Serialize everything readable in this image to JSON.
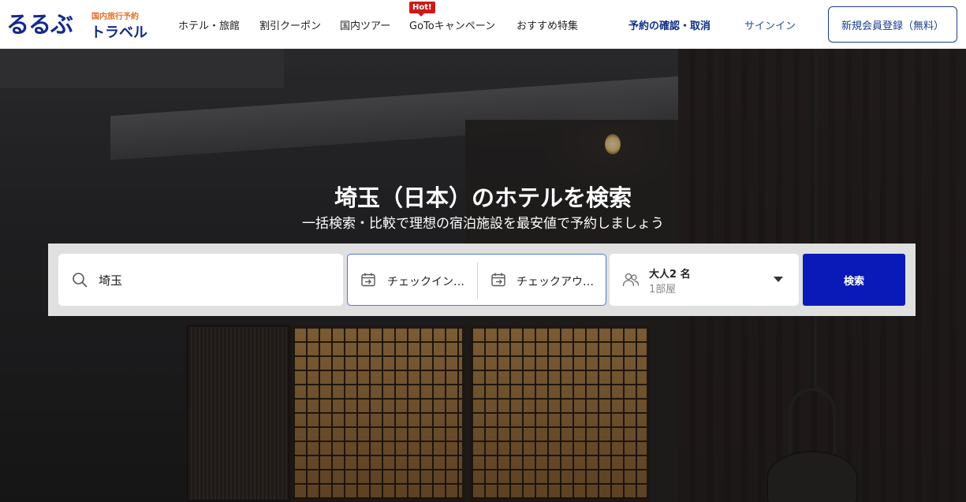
{
  "brand": {
    "logo_main": "るるぶ",
    "logo_sub": "国内旅行予約",
    "logo_travel": "トラベル"
  },
  "nav": {
    "items": [
      "ホテル・旅館",
      "割引クーポン",
      "国内ツアー",
      "GoToキャンペーン",
      "おすすめ特集"
    ],
    "hot_badge": "Hot!",
    "reservation": "予約の確認・取消",
    "signin": "サインイン",
    "register": "新規会員登録（無料）"
  },
  "hero": {
    "title": "埼玉（日本）のホテルを検索",
    "subtitle": "一括検索・比較で理想の宿泊施設を最安値で予約しましょう"
  },
  "search": {
    "destination": "埼玉",
    "checkin": "チェックイン…",
    "checkout": "チェックアウ…",
    "guests": "大人2 名",
    "rooms": "1部屋",
    "button": "検索"
  },
  "icons": {
    "search": "search-icon",
    "calendar_in": "calendar-checkin-icon",
    "calendar_out": "calendar-checkout-icon",
    "guests": "people-icon",
    "dropdown": "caret-down-icon"
  },
  "colors": {
    "brand_navy": "#152a8b",
    "brand_orange": "#e0702a",
    "search_button": "#0a1ab8",
    "hot_badge": "#cc1a1a"
  }
}
